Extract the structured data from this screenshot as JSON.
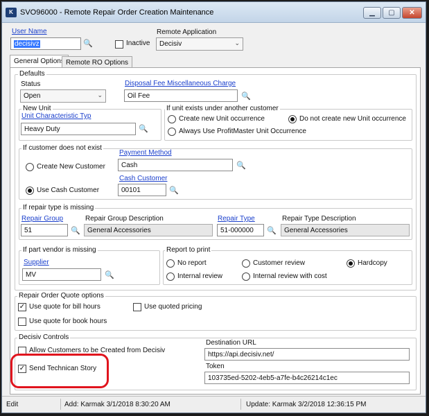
{
  "window": {
    "app_icon": "K",
    "title": "SVO96000 - Remote Repair Order Creation Maintenance",
    "minimize_icon": "minimize-icon",
    "maximize_icon": "maximize-icon",
    "close_icon": "close-icon"
  },
  "header": {
    "user_name_label": "User Name",
    "user_name_value": "decisivz",
    "inactive_label": "Inactive",
    "inactive_checked": false,
    "remote_app_label": "Remote Application",
    "remote_app_value": "Decisiv"
  },
  "tabs": [
    {
      "label": "General Options",
      "active": true
    },
    {
      "label": "Remote RO Options",
      "active": false
    }
  ],
  "defaults": {
    "group_label": "Defaults",
    "status_label": "Status",
    "status_value": "Open",
    "disposal_fee_label": "Disposal Fee Miscellaneous Charge",
    "disposal_fee_value": "Oil Fee"
  },
  "new_unit": {
    "group_label": "New Unit",
    "unit_char_label": "Unit Characteristic Typ",
    "unit_char_value": "Heavy Duty"
  },
  "unit_exists": {
    "group_label": "If unit exists under another customer",
    "options": [
      {
        "label": "Create new Unit occurrence",
        "selected": false
      },
      {
        "label": "Do not create new Unit occurrence",
        "selected": true
      },
      {
        "label": "Always Use ProfitMaster Unit Occurrence",
        "selected": false
      }
    ]
  },
  "customer_missing": {
    "group_label": "If customer does not exist",
    "create_new_label": "Create New Customer",
    "use_cash_label": "Use Cash Customer",
    "selected": "use_cash",
    "payment_method_label": "Payment Method",
    "payment_method_value": "Cash",
    "cash_customer_label": "Cash Customer",
    "cash_customer_value": "00101"
  },
  "repair_type_missing": {
    "group_label": "If repair type is missing",
    "repair_group_label": "Repair Group",
    "repair_group_value": "51",
    "repair_group_desc_label": "Repair Group Description",
    "repair_group_desc_value": "General Accessories",
    "repair_type_label": "Repair Type",
    "repair_type_value": "51-000000",
    "repair_type_desc_label": "Repair Type Description",
    "repair_type_desc_value": "General Accessories"
  },
  "vendor_missing": {
    "group_label": "If part vendor is missing",
    "supplier_label": "Supplier",
    "supplier_value": "MV"
  },
  "report_to_print": {
    "group_label": "Report to print",
    "options": [
      {
        "label": "No report",
        "selected": false
      },
      {
        "label": "Customer review",
        "selected": false
      },
      {
        "label": "Hardcopy",
        "selected": true
      },
      {
        "label": "Internal review",
        "selected": false
      },
      {
        "label": "Internal review with cost",
        "selected": false
      }
    ]
  },
  "quote_options": {
    "group_label": "Repair Order Quote options",
    "bill_hours_label": "Use quote for bill hours",
    "bill_hours_checked": true,
    "quoted_pricing_label": "Use quoted pricing",
    "quoted_pricing_checked": false,
    "book_hours_label": "Use quote for book hours",
    "book_hours_checked": false
  },
  "decisiv_controls": {
    "group_label": "Decisiv Controls",
    "allow_customers_label": "Allow Customers to be Created from Decisiv",
    "allow_customers_checked": false,
    "send_story_label": "Send Technican Story",
    "send_story_checked": true,
    "destination_url_label": "Destination URL",
    "destination_url_value": "https://api.decisiv.net/",
    "token_label": "Token",
    "token_value": "103735ed-5202-4eb5-a7fe-b4c26214c1ec"
  },
  "status_bar": {
    "mode": "Edit",
    "added": "Add: Karmak 3/1/2018 8:30:20 AM",
    "updated": "Update: Karmak 3/2/2018 12:36:15 PM"
  },
  "icons": {
    "lookup": "binoculars-icon",
    "dropdown": "chevron-down-icon",
    "check": "checkmark-icon"
  },
  "colors": {
    "link": "#1a3fcc",
    "highlight_box": "#e0141d",
    "selected_text_bg": "#3377ff"
  }
}
